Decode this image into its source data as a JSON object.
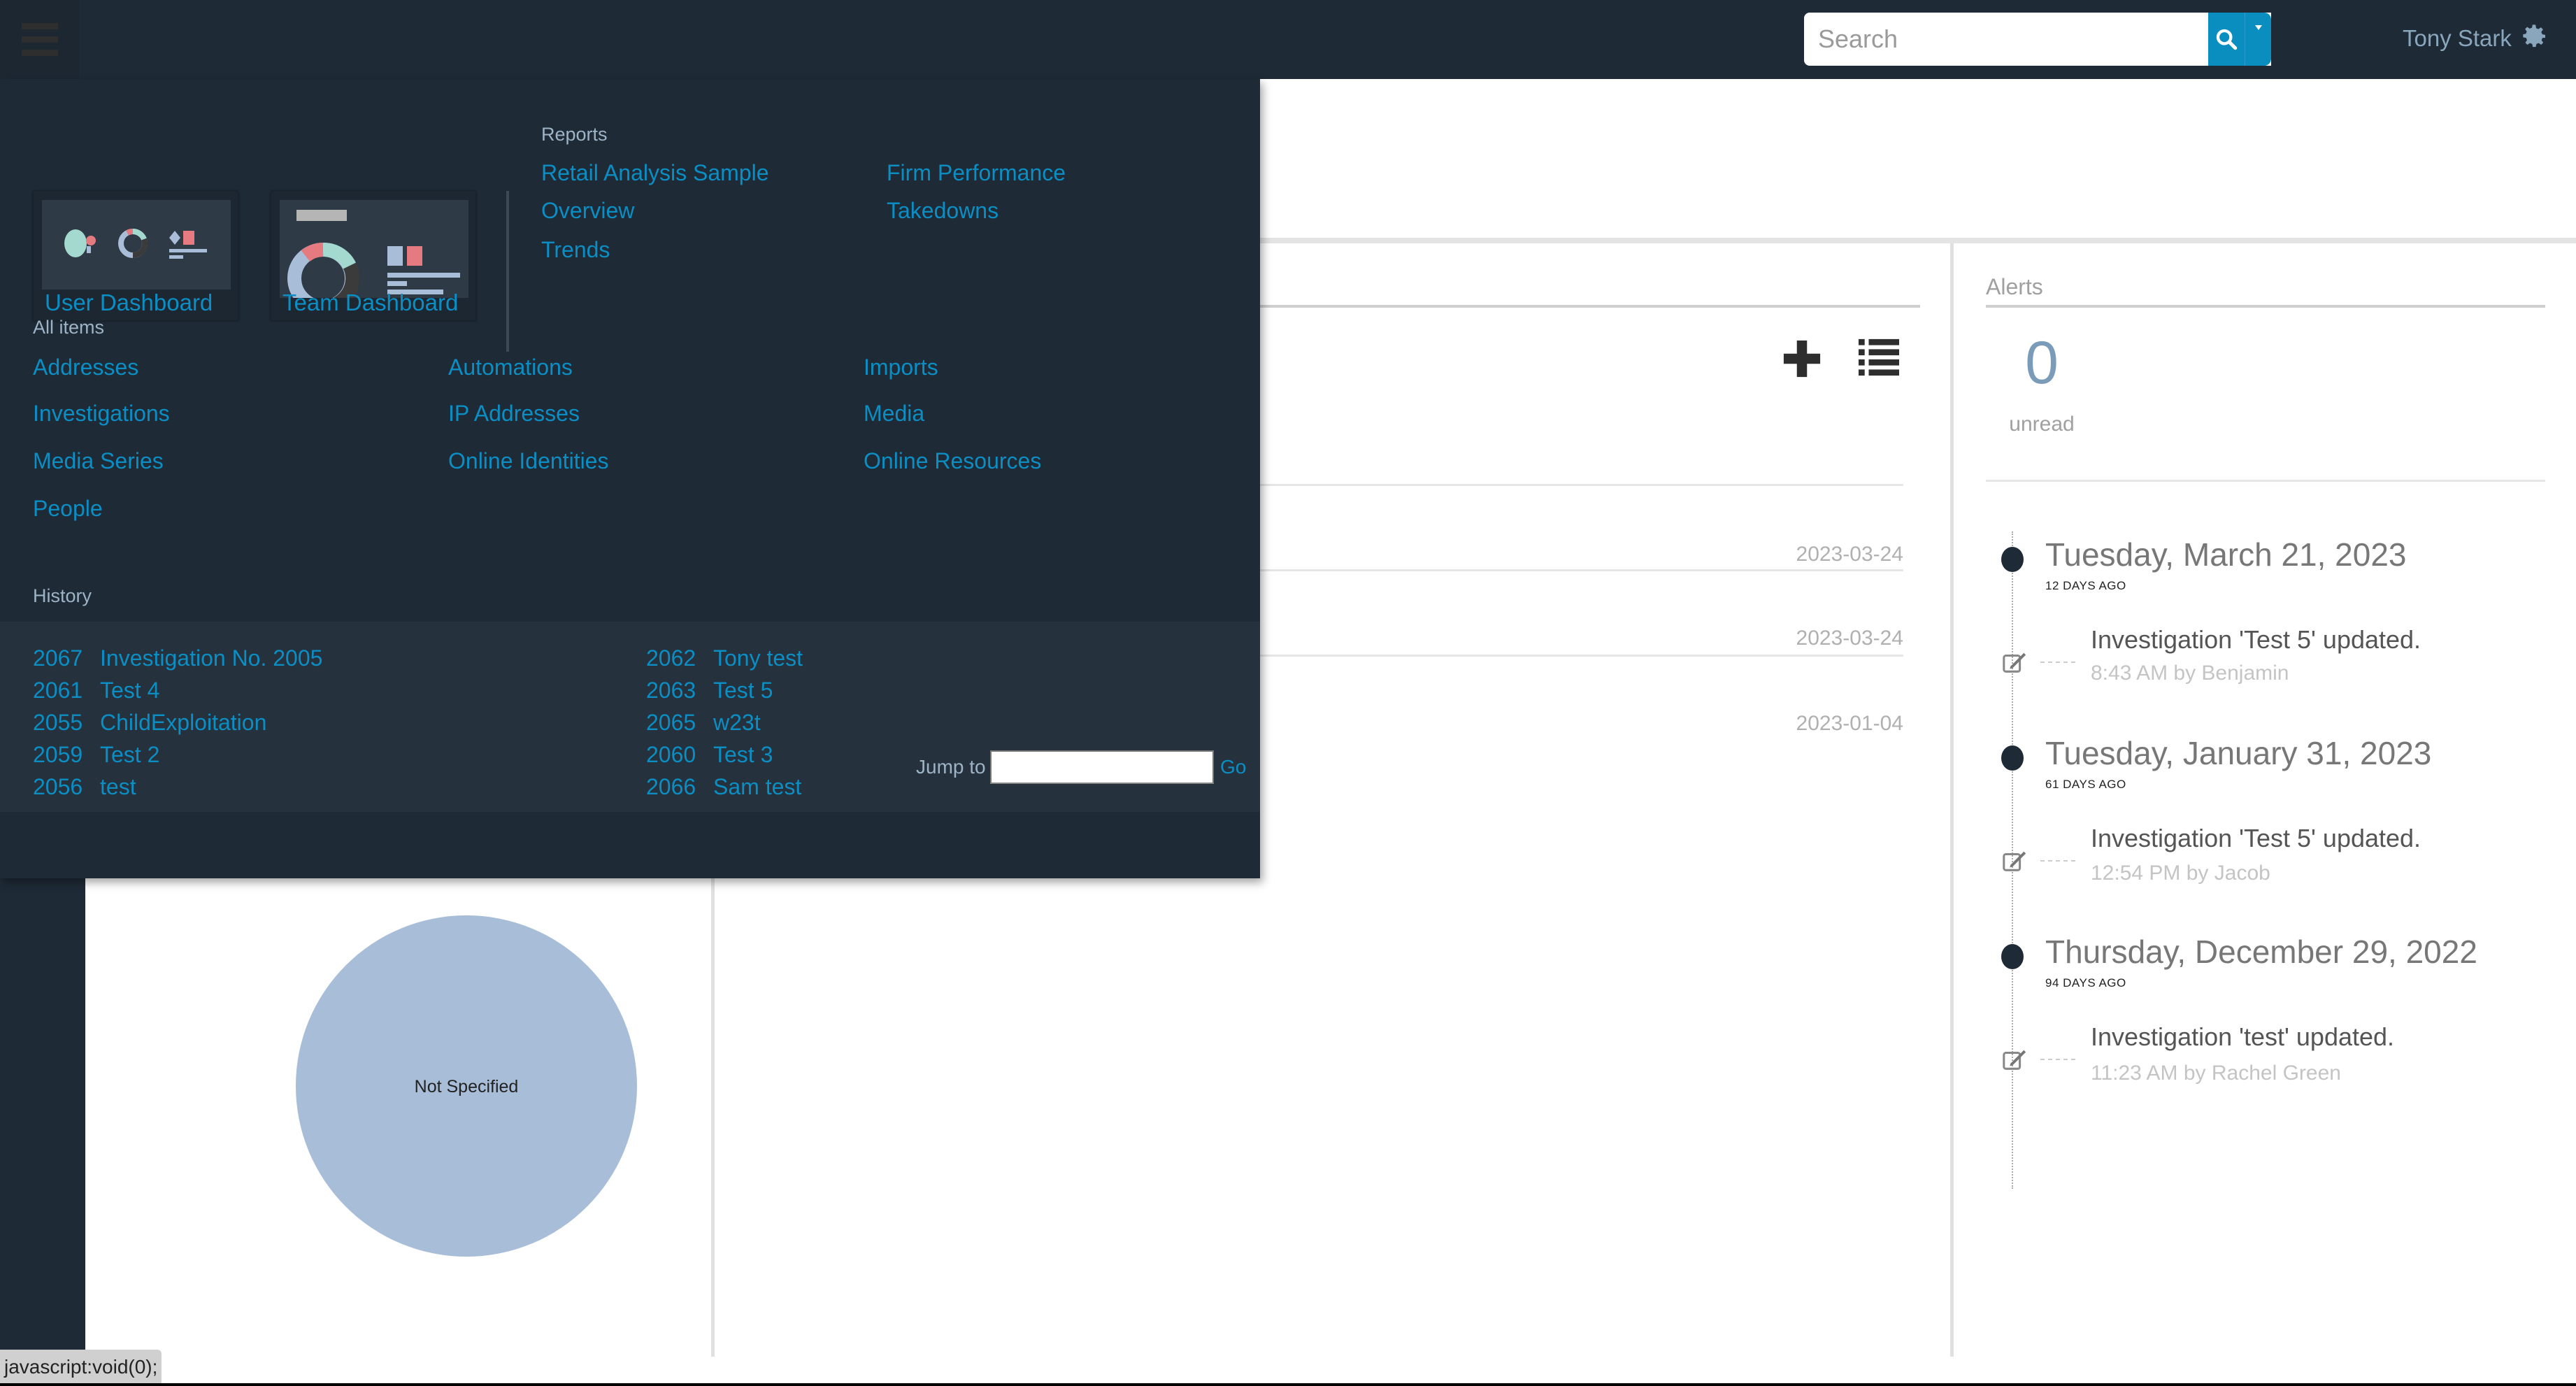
{
  "topbar": {
    "search_placeholder": "Search",
    "user_name": "Tony Stark",
    "icons": [
      "menu-icon",
      "search-icon",
      "caret-down-icon",
      "gear-icon"
    ]
  },
  "flyout": {
    "dashboards": [
      {
        "label": "User Dashboard"
      },
      {
        "label": "Team Dashboard"
      }
    ],
    "reports": {
      "title": "Reports",
      "links": [
        "Retail Analysis Sample",
        "Overview",
        "Trends",
        "Firm Performance",
        "Takedowns"
      ]
    },
    "all_items": {
      "title": "All items",
      "links": [
        "Addresses",
        "Investigations",
        "Media Series",
        "People",
        "Automations",
        "IP Addresses",
        "Online Identities",
        "Imports",
        "Media",
        "Online Resources"
      ]
    },
    "history": {
      "title": "History",
      "items": [
        {
          "id": "2067",
          "name": "Investigation No. 2005"
        },
        {
          "id": "2061",
          "name": "Test 4"
        },
        {
          "id": "2055",
          "name": "ChildExploitation"
        },
        {
          "id": "2059",
          "name": "Test 2"
        },
        {
          "id": "2056",
          "name": "test"
        },
        {
          "id": "2062",
          "name": "Tony test"
        },
        {
          "id": "2063",
          "name": "Test 5"
        },
        {
          "id": "2065",
          "name": "w23t"
        },
        {
          "id": "2060",
          "name": "Test 3"
        },
        {
          "id": "2066",
          "name": "Sam test"
        }
      ]
    },
    "jump": {
      "label": "Jump to",
      "value": "",
      "go_label": "Go"
    }
  },
  "list_panel": {
    "icons": [
      "plus-icon",
      "list-icon"
    ],
    "rows": [
      {
        "date": "2023-03-24"
      },
      {
        "date": "2023-03-24"
      },
      {
        "date": "2023-01-04"
      }
    ]
  },
  "alerts": {
    "title": "Alerts",
    "count": "0",
    "count_label": "unread",
    "timeline": [
      {
        "date": "Tuesday, March 21, 2023",
        "ago": "12 DAYS AGO",
        "message": "Investigation 'Test 5' updated.",
        "meta": "8:43 AM by Benjamin"
      },
      {
        "date": "Tuesday, January 31, 2023",
        "ago": "61 DAYS AGO",
        "message": "Investigation 'Test 5' updated.",
        "meta": "12:54 PM by Jacob"
      },
      {
        "date": "Thursday, December 29, 2022",
        "ago": "94 DAYS AGO",
        "message": "Investigation 'test' updated.",
        "meta": "11:23 AM by Rachel Green"
      }
    ]
  },
  "chart_data": {
    "type": "pie",
    "title": "",
    "categories": [
      "Not Specified"
    ],
    "values": [
      100
    ],
    "colors": [
      "#a8bdd7"
    ]
  },
  "status_bar": {
    "url": "javascript:void(0);"
  },
  "colors": {
    "nav_bg": "#1e2a36",
    "link": "#0b8ec4",
    "accent_button": "#0a8ec0",
    "pie_fill": "#a8bdd7"
  }
}
